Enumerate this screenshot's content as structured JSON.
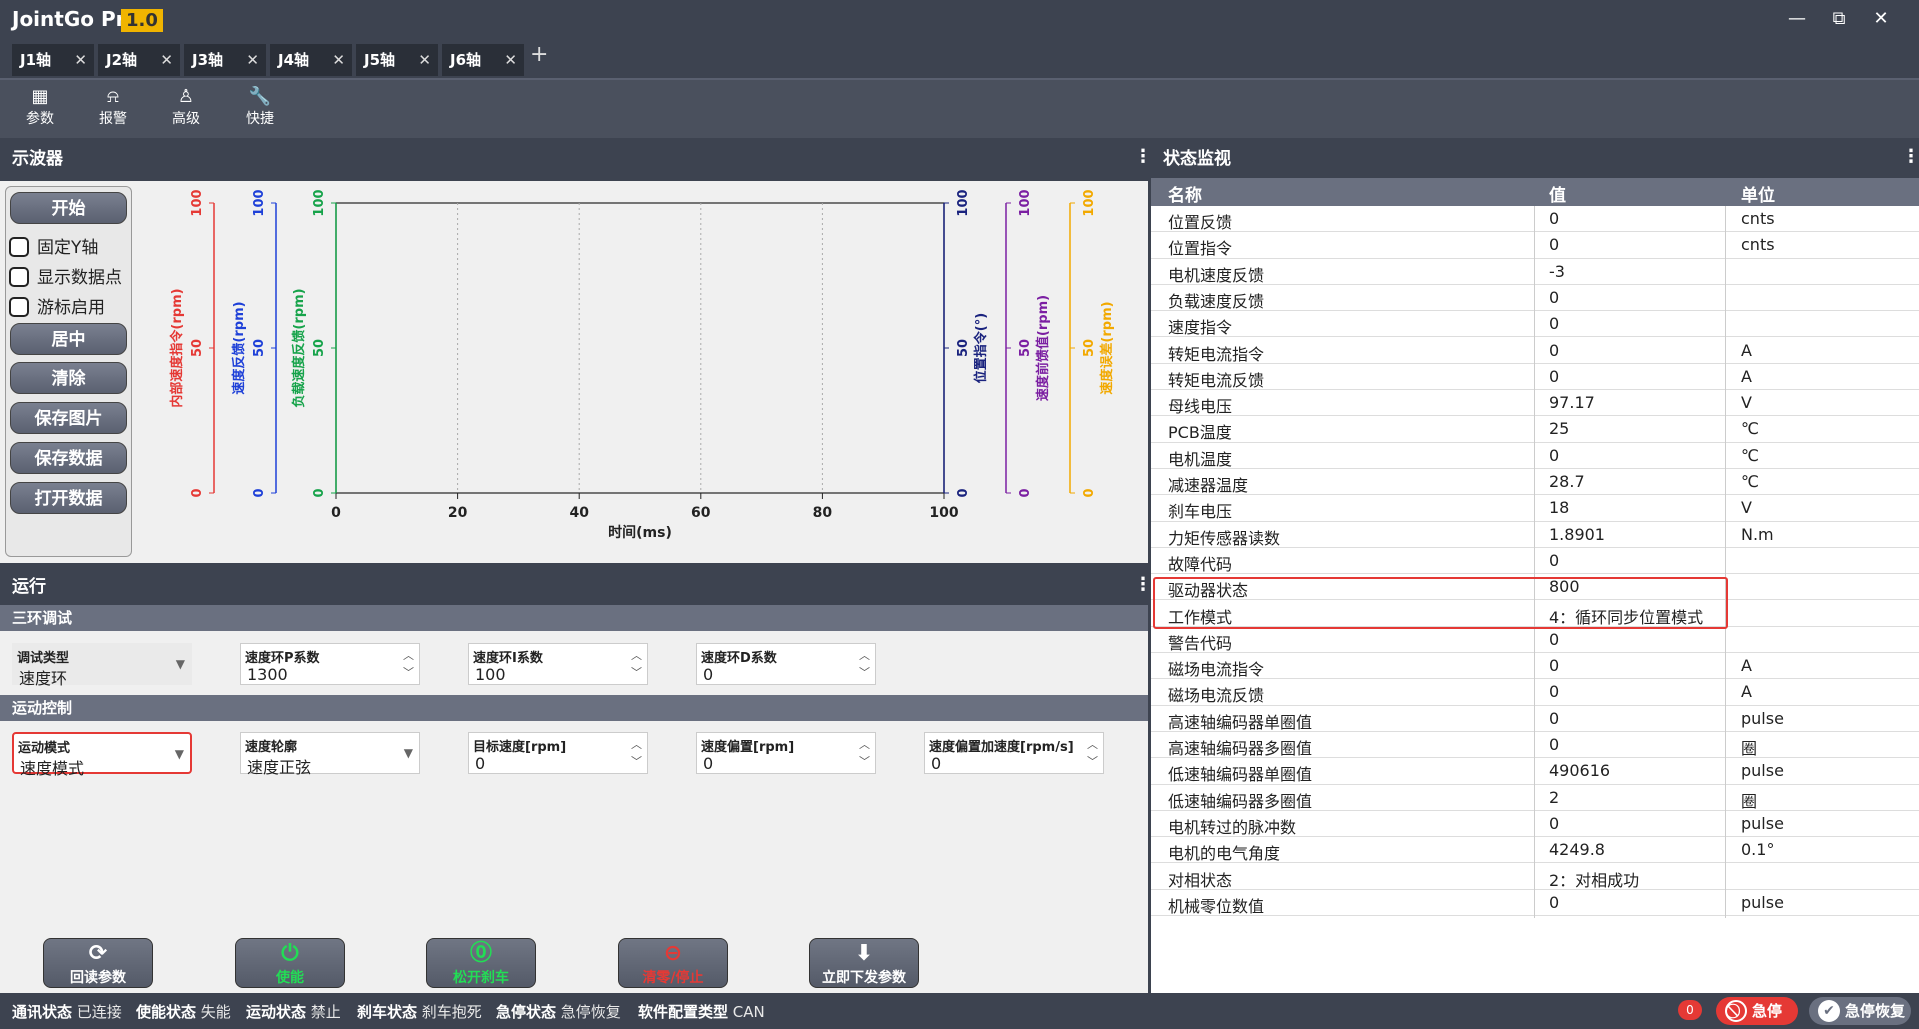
{
  "app": {
    "title": "JointGo Pro",
    "version": "1.0"
  },
  "window": {
    "minimize": "—",
    "restore": "⧉",
    "close": "✕"
  },
  "tabs": [
    {
      "label": "J1轴"
    },
    {
      "label": "J2轴"
    },
    {
      "label": "J3轴"
    },
    {
      "label": "J4轴"
    },
    {
      "label": "J5轴"
    },
    {
      "label": "J6轴"
    }
  ],
  "toolbar": [
    {
      "label": "参数",
      "icon": "grid-icon"
    },
    {
      "label": "报警",
      "icon": "alarm-icon"
    },
    {
      "label": "高级",
      "icon": "user-icon"
    },
    {
      "label": "快捷",
      "icon": "wrench-icon"
    }
  ],
  "scope": {
    "title": "示波器",
    "buttons": {
      "start": "开始",
      "center": "居中",
      "clear": "清除",
      "save_image": "保存图片",
      "save_data": "保存数据",
      "open_data": "打开数据"
    },
    "checks": {
      "fix_y": "固定Y轴",
      "show_points": "显示数据点",
      "cursor": "游标启用"
    },
    "chart_data": {
      "type": "line",
      "xlabel": "时间(ms)",
      "xlim": [
        0,
        100
      ],
      "x_ticks": [
        "0",
        "20",
        "40",
        "60",
        "80",
        "100"
      ],
      "grid": true,
      "axes_left": [
        {
          "label": "内部速度指令(rpm)",
          "color": "#e53935",
          "ticks": [
            "0",
            "50",
            "100"
          ]
        },
        {
          "label": "速度反馈(rpm)",
          "color": "#1e40d8",
          "ticks": [
            "0",
            "50",
            "100"
          ]
        },
        {
          "label": "负载速度反馈(rpm)",
          "color": "#16a34a",
          "ticks": [
            "0",
            "50",
            "100"
          ]
        }
      ],
      "axes_right": [
        {
          "label": "位置指令(°)",
          "color": "#1a237e",
          "ticks": [
            "0",
            "50",
            "100"
          ]
        },
        {
          "label": "速度前馈值(rpm)",
          "color": "#7b1fa2",
          "ticks": [
            "0",
            "50",
            "100"
          ]
        },
        {
          "label": "速度误差(rpm)",
          "color": "#f2a900",
          "ticks": [
            "0",
            "50",
            "100"
          ]
        }
      ],
      "series": []
    }
  },
  "run": {
    "title": "运行",
    "section_loop": "三环调试",
    "section_motion": "运动控制",
    "fields_loop": [
      {
        "label": "调试类型",
        "value": "速度环"
      },
      {
        "label": "速度环P系数",
        "value": "1300"
      },
      {
        "label": "速度环I系数",
        "value": "100"
      },
      {
        "label": "速度环D系数",
        "value": "0"
      }
    ],
    "fields_motion": [
      {
        "label": "运动模式",
        "value": "速度模式"
      },
      {
        "label": "速度轮廓",
        "value": "速度正弦"
      },
      {
        "label": "目标速度[rpm]",
        "value": "0"
      },
      {
        "label": "速度偏置[rpm]",
        "value": "0"
      },
      {
        "label": "速度偏置加速度[rpm/s]",
        "value": "0"
      }
    ],
    "actions": [
      {
        "label": "回读参数",
        "icon": "refresh-icon",
        "color": "#ffffff"
      },
      {
        "label": "使能",
        "icon": "power-icon",
        "color": "#22dd55"
      },
      {
        "label": "松开刹车",
        "icon": "brake-icon",
        "color": "#22dd55"
      },
      {
        "label": "清零/停止",
        "icon": "stop-icon",
        "color": "#e53935"
      },
      {
        "label": "立即下发参数",
        "icon": "download-icon",
        "color": "#ffffff"
      }
    ]
  },
  "monitor": {
    "title": "状态监视",
    "columns": [
      "名称",
      "值",
      "单位"
    ],
    "rows": [
      [
        "位置反馈",
        "0",
        "cnts"
      ],
      [
        "位置指令",
        "0",
        "cnts"
      ],
      [
        "电机速度反馈",
        "-3",
        ""
      ],
      [
        "负载速度反馈",
        "0",
        ""
      ],
      [
        "速度指令",
        "0",
        ""
      ],
      [
        "转矩电流指令",
        "0",
        "A"
      ],
      [
        "转矩电流反馈",
        "0",
        "A"
      ],
      [
        "母线电压",
        "97.17",
        "V"
      ],
      [
        "PCB温度",
        "25",
        "℃"
      ],
      [
        "电机温度",
        "0",
        "℃"
      ],
      [
        "减速器温度",
        "28.7",
        "℃"
      ],
      [
        "刹车电压",
        "18",
        "V"
      ],
      [
        "力矩传感器读数",
        "1.8901",
        "N.m"
      ],
      [
        "故障代码",
        "0",
        ""
      ],
      [
        "驱动器状态",
        "800",
        ""
      ],
      [
        "工作模式",
        "4：循环同步位置模式",
        ""
      ],
      [
        "警告代码",
        "0",
        ""
      ],
      [
        "磁场电流指令",
        "0",
        "A"
      ],
      [
        "磁场电流反馈",
        "0",
        "A"
      ],
      [
        "高速轴编码器单圈值",
        "0",
        "pulse"
      ],
      [
        "高速轴编码器多圈值",
        "0",
        "圈"
      ],
      [
        "低速轴编码器单圈值",
        "490616",
        "pulse"
      ],
      [
        "低速轴编码器多圈值",
        "2",
        "圈"
      ],
      [
        "电机转过的脉冲数",
        "0",
        "pulse"
      ],
      [
        "电机的电气角度",
        "4249.8",
        "0.1°"
      ],
      [
        "对相状态",
        "2：对相成功",
        ""
      ],
      [
        "机械零位数值",
        "0",
        "pulse"
      ]
    ]
  },
  "statusbar": {
    "items": [
      {
        "key": "通讯状态",
        "value": "已连接"
      },
      {
        "key": "使能状态",
        "value": "失能"
      },
      {
        "key": "运动状态",
        "value": "禁止"
      },
      {
        "key": "刹车状态",
        "value": "刹车抱死"
      },
      {
        "key": "急停状态",
        "value": "急停恢复"
      },
      {
        "key": "软件配置类型",
        "value": "CAN"
      }
    ],
    "badge": "0",
    "estop": "急停",
    "recover": "急停恢复"
  }
}
